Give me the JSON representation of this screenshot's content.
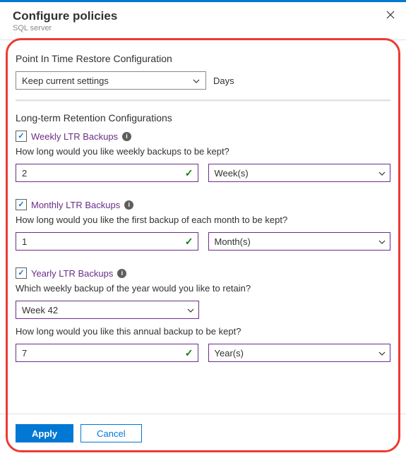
{
  "header": {
    "title": "Configure policies",
    "subtitle": "SQL server"
  },
  "pitr": {
    "title": "Point In Time Restore Configuration",
    "selected": "Keep current settings",
    "unit": "Days"
  },
  "ltr": {
    "title": "Long-term Retention Configurations",
    "weekly": {
      "label": "Weekly LTR Backups",
      "question": "How long would you like weekly backups to be kept?",
      "value": "2",
      "unit": "Week(s)"
    },
    "monthly": {
      "label": "Monthly LTR Backups",
      "question": "How long would you like the first backup of each month to be kept?",
      "value": "1",
      "unit": "Month(s)"
    },
    "yearly": {
      "label": "Yearly LTR Backups",
      "question1": "Which weekly backup of the year would you like to retain?",
      "week": "Week 42",
      "question2": "How long would you like this annual backup to be kept?",
      "value": "7",
      "unit": "Year(s)"
    }
  },
  "footer": {
    "apply": "Apply",
    "cancel": "Cancel"
  }
}
